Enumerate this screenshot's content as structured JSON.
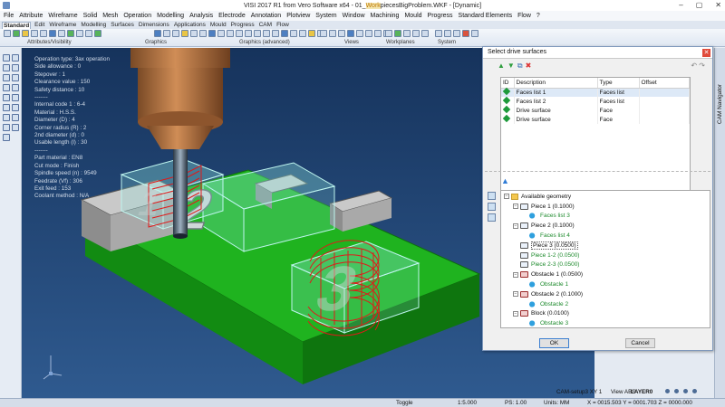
{
  "window": {
    "title_prefix": "VISI 2017 R1   from Vero Software x64 - 01_",
    "title_highlight": "Work",
    "title_suffix": "piecesBigProblem.WKF - [Dynamic]",
    "minimize": "–",
    "maximize": "▢",
    "close": "✕"
  },
  "menu": [
    "File",
    "Attribute",
    "Wireframe",
    "Solid",
    "Mesh",
    "Operation",
    "Modelling",
    "Analysis",
    "Electrode",
    "Annotation",
    "Plotview",
    "System",
    "Window",
    "Machining",
    "Mould",
    "Progress",
    "Standard Elements",
    "Flow",
    "?"
  ],
  "tabs": [
    "Standard",
    "Edit",
    "Wireframe",
    "Modelling",
    "Surfaces",
    "Dimensions",
    "Applications",
    "Mould",
    "Progress",
    "CAM",
    "Flow"
  ],
  "ribbon_groups": [
    "Attributes/Visibility",
    "Graphics",
    "Graphics (advanced)",
    "Views",
    "Workplanes",
    "System"
  ],
  "operation_info": [
    "Operation type: 3ax operation",
    "Side allowance : 0",
    "Stepover : 1",
    "Clearance value : 150",
    "Safety distance : 10",
    "-------",
    "Internal code 1 : 6-4",
    "Material : H.S.S.",
    "Diameter (D) : 4",
    "Corner radius (R) : 2",
    "2nd diameter (d) : 0",
    "Usable length (l) : 30",
    "-------",
    "Part material : EN8",
    "Cut mode : Finish",
    "Spindle speed (n) : 9549",
    "Feedrate (Vf) : 306",
    "Exit feed : 153",
    "Coolant method : N/A"
  ],
  "viewport_labels": {
    "letter_one": "1",
    "letter_two": "2",
    "letter_three": "3"
  },
  "dialog": {
    "title": "Select drive surfaces",
    "close": "✕",
    "tools": [
      "▲",
      "▼",
      "⧉",
      "✖"
    ],
    "undo_redo": "↶ ↷",
    "columns": [
      "ID",
      "Description",
      "Type",
      "Offset"
    ],
    "rows": [
      {
        "description": "Faces list 1",
        "type": "Faces list",
        "offset": "",
        "selected": true
      },
      {
        "description": "Faces list 2",
        "type": "Faces list",
        "offset": "",
        "selected": false
      },
      {
        "description": "Drive surface",
        "type": "Face",
        "offset": "",
        "selected": false
      },
      {
        "description": "Drive surface",
        "type": "Face",
        "offset": "",
        "selected": false
      }
    ],
    "tree_icon": "▲",
    "tree": [
      {
        "label": "Available geometry",
        "level": 0,
        "kind": "folder",
        "expander": "−",
        "style": ""
      },
      {
        "label": "Piece 1 (0.1000)",
        "level": 1,
        "kind": "piece",
        "expander": "−",
        "style": ""
      },
      {
        "label": "Faces list 3",
        "level": 2,
        "kind": "faces",
        "expander": "",
        "style": "green"
      },
      {
        "label": "Piece 2 (0.1000)",
        "level": 1,
        "kind": "piece",
        "expander": "−",
        "style": ""
      },
      {
        "label": "Faces list 4",
        "level": 2,
        "kind": "faces",
        "expander": "",
        "style": "green"
      },
      {
        "label": "Piece 3 (0.0500)",
        "level": 1,
        "kind": "piece",
        "expander": "",
        "style": "boxed"
      },
      {
        "label": "Piece 1-2 (0.0500)",
        "level": 1,
        "kind": "piece",
        "expander": "",
        "style": "green"
      },
      {
        "label": "Piece 2-3 (0.0500)",
        "level": 1,
        "kind": "piece",
        "expander": "",
        "style": "green"
      },
      {
        "label": "Obstacle 1 (0.0500)",
        "level": 1,
        "kind": "obstacle",
        "expander": "−",
        "style": ""
      },
      {
        "label": "Obstacle 1",
        "level": 2,
        "kind": "faces",
        "expander": "",
        "style": "green"
      },
      {
        "label": "Obstacle 2 (0.1000)",
        "level": 1,
        "kind": "obstacle",
        "expander": "−",
        "style": ""
      },
      {
        "label": "Obstacle 2",
        "level": 2,
        "kind": "faces",
        "expander": "",
        "style": "green"
      },
      {
        "label": "Block (0.0100)",
        "level": 1,
        "kind": "obstacle",
        "expander": "−",
        "style": ""
      },
      {
        "label": "Obstacle 3",
        "level": 2,
        "kind": "faces",
        "expander": "",
        "style": "green"
      }
    ],
    "ok_label": "OK",
    "cancel_label": "Cancel"
  },
  "cam_navigator_label": "CAM Navigator",
  "status": {
    "toggle": "Toggle",
    "scale": "1:5.000",
    "ps": "PS: 1.00",
    "units": "Units: MM",
    "coords": "X = 0015.503  Y = 0001.703  Z = 0000.000",
    "setup": "CAM-setup3 XY 1",
    "view": "View ABS",
    "layer": "LAYER0"
  },
  "colors": {
    "viewport_bg": "#1f3d68",
    "block_green": "#1fb31f",
    "toolpath_red": "#e11919",
    "selection_cyan": "#8fe7e0"
  }
}
